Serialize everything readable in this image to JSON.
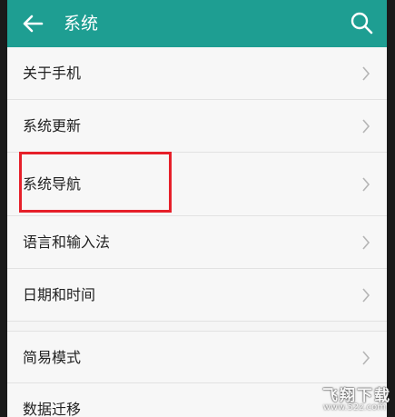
{
  "header": {
    "title": "系统",
    "back_icon": "arrow-left-icon",
    "search_icon": "search-icon"
  },
  "colors": {
    "appbar": "#1e9e92",
    "highlight": "#e6202a"
  },
  "items": [
    {
      "label": "关于手机"
    },
    {
      "label": "系统更新"
    },
    {
      "label": "系统导航"
    },
    {
      "label": "语言和输入法"
    },
    {
      "label": "日期和时间"
    },
    {
      "label": "简易模式"
    },
    {
      "label": "数据迁移"
    }
  ],
  "watermark": {
    "brand": "飞翔下载",
    "url": "www.52z.com"
  }
}
